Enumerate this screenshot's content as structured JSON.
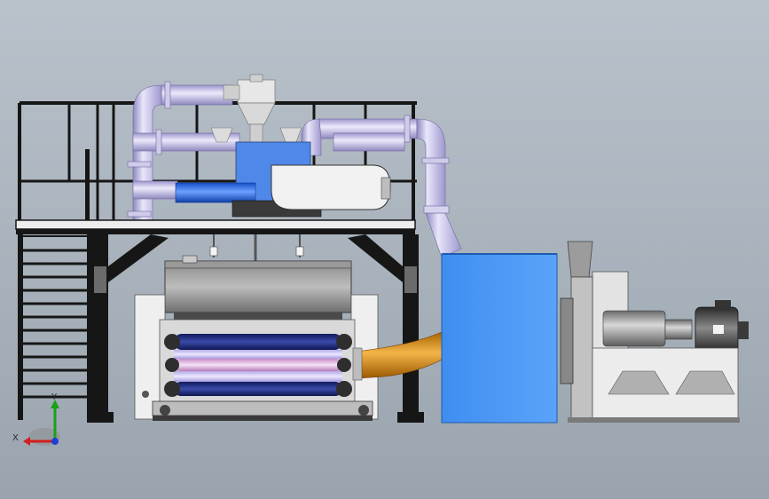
{
  "viewport": {
    "background_top": "#b9c2cb",
    "background_bottom": "#9aa4ae"
  },
  "colors": {
    "frame_black": "#161616",
    "pipe_lavender": "#c9c4ea",
    "pipe_shadow": "#8f89bf",
    "motor_blue": "#4f88e8",
    "blue_box": "#4d98f3",
    "orange_duct": "#e69a1a",
    "roller_navy": "#1e2a78",
    "roller_pink": "#d8a9d8",
    "steel_gray": "#9a9a9a",
    "white_block": "#ececec"
  },
  "triad": {
    "x_label": "X",
    "y_label": "Y",
    "x_color": "#d21f1f",
    "y_color": "#1aa01a",
    "z_color": "#1f3fd2"
  },
  "icons": {
    "triad": "coordinate-triad-icon"
  }
}
